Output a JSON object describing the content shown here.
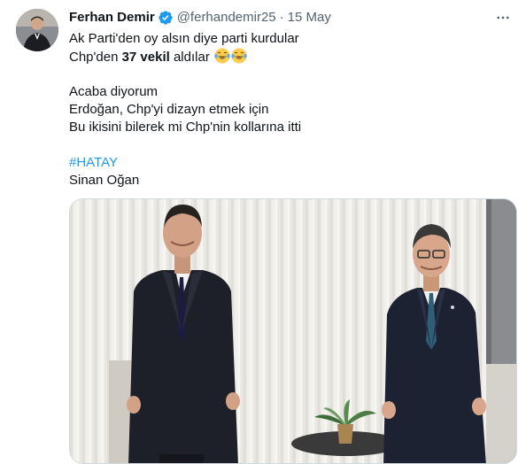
{
  "tweet": {
    "author": {
      "name": "Ferhan Demir",
      "handle": "@ferhandemir25",
      "verified": true
    },
    "separator": "·",
    "date": "15 May",
    "more_icon": "ellipsis-icon",
    "text": {
      "line1": "Ak Parti'den oy alsın diye parti kurdular",
      "line2_prefix": "Chp'den ",
      "line2_bold": "37 vekil",
      "line2_suffix": " aldılar",
      "line2_emoji": "face-with-tears-of-joy",
      "line3": "Acaba diyorum",
      "line4": "Erdoğan, Chp'yi dizayn etmek için",
      "line5": "Bu ikisini bilerek mi Chp'nin kollarına itti",
      "hashtag": "#HATAY",
      "line7": "Sinan Oğan"
    },
    "media": {
      "type": "photo"
    },
    "colors": {
      "link": "#1d9bf0",
      "secondary": "#536471",
      "verified": "#1d9bf0"
    }
  }
}
